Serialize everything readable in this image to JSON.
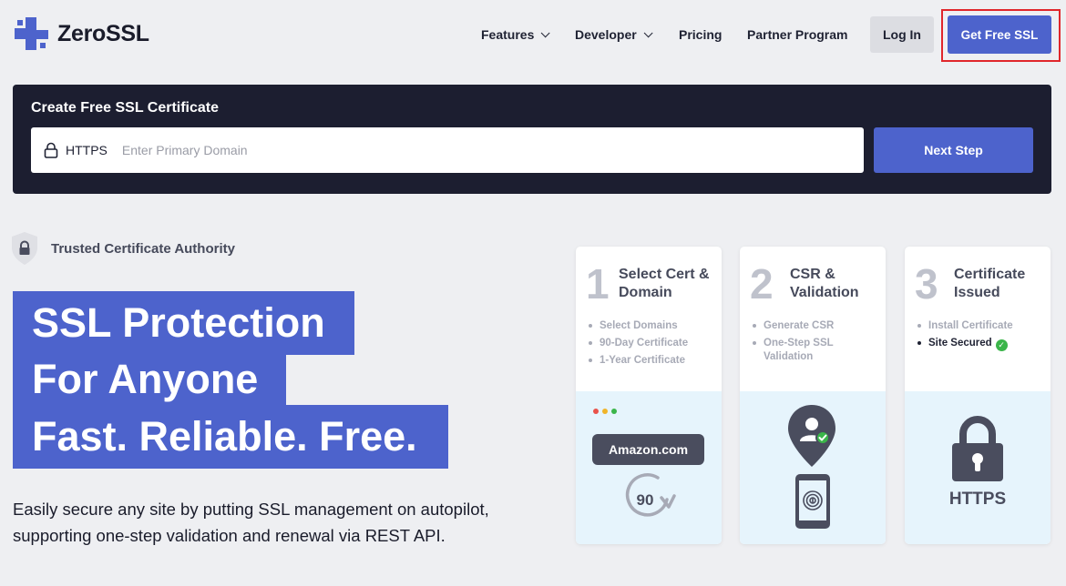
{
  "brand": {
    "name": "ZeroSSL",
    "primary": "#4d63cc",
    "dark": "#1c1e30",
    "highlight": "#e0262b"
  },
  "nav": {
    "items": [
      {
        "label": "Features",
        "dropdown": true
      },
      {
        "label": "Developer",
        "dropdown": true
      },
      {
        "label": "Pricing",
        "dropdown": false
      },
      {
        "label": "Partner Program",
        "dropdown": false
      }
    ],
    "login": "Log In",
    "get_free": "Get Free SSL"
  },
  "create": {
    "title": "Create Free SSL Certificate",
    "protocol": "HTTPS",
    "placeholder": "Enter Primary Domain",
    "value": "",
    "next": "Next Step"
  },
  "trusted": "Trusted Certificate Authority",
  "hero": {
    "line1": "SSL Protection",
    "line2": "For Anyone",
    "line3": "Fast. Reliable. Free.",
    "sub1": "Easily secure any site by putting SSL management on autopilot,",
    "sub2": "supporting one-step validation and renewal via REST API."
  },
  "steps": [
    {
      "num": "1",
      "title": "Select Cert & Domain",
      "items": [
        "Select Domains",
        "90-Day Certificate",
        "1-Year Certificate"
      ]
    },
    {
      "num": "2",
      "title": "CSR & Validation",
      "items": [
        "Generate CSR",
        "One-Step SSL Validation"
      ]
    },
    {
      "num": "3",
      "title": "Certificate Issued",
      "items": [
        "Install Certificate",
        "Site Secured"
      ]
    }
  ],
  "illustrations": {
    "domain": "Amazon.com",
    "days": "90",
    "protocol": "HTTPS"
  }
}
